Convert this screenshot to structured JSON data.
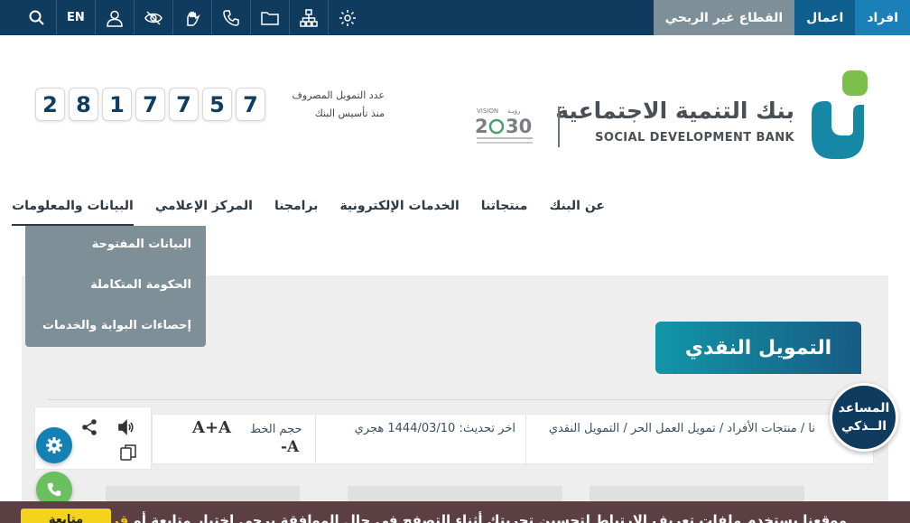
{
  "topbar": {
    "segments": [
      "افراد",
      "اعمال",
      "القطاع غير الربحي"
    ],
    "language": "EN",
    "tool_icons": [
      "search-icon",
      "language-toggle",
      "user-icon",
      "eye-slash-icon",
      "sign-language-icon",
      "phone-icon",
      "folder-icon",
      "sitemap-icon",
      "settings-icon"
    ]
  },
  "header": {
    "bank_name_ar": "بنك التنمية الاجتماعية",
    "bank_name_en": "SOCIAL DEVELOPMENT BANK",
    "vision_logo": "VISION 2030",
    "counter_label_1": "عدد التمويل المصروف",
    "counter_label_2": "منذ تأسيس البنك",
    "counter_digits": [
      "2",
      "8",
      "1",
      "7",
      "7",
      "5",
      "7"
    ]
  },
  "nav": {
    "items": [
      "عن البنك",
      "منتجاتنا",
      "الخدمات الإلكترونية",
      "برامجنا",
      "المركز الإعلامي",
      "البيانات والمعلومات"
    ],
    "active": "البيانات والمعلومات"
  },
  "dropdown": {
    "items": [
      "البيانات المفتوحة",
      "الحكومة المتكاملة",
      "إحصاءات البوابة والخدمات"
    ]
  },
  "page": {
    "title": "التمويل النقدي",
    "breadcrumb": "نا / منتجات الأفراد / تمويل العمل الحر / التمويل النقدي",
    "last_update": "اخر تحديث: 1444/03/10 هجري",
    "font_size_label": "حجم الخط",
    "font_increase": "A+A",
    "font_decrease": "-A"
  },
  "assistant": {
    "line1": "المساعد",
    "line2": "الــذكي"
  },
  "cookie": {
    "text": "موقعنا يستخدم ملفات تعريف الارتباط لتحسين تجربتك أثناء التصفح في حال الموافقة يرجى اختيار متابعة أو",
    "link": "قراءة المزيد",
    "button": "متابعة"
  },
  "colors": {
    "topbar": "#0f3b5f",
    "accent": "#1580b4",
    "teal": "#1296a6",
    "dropdown": "#7e8f98",
    "cookie_bar": "#5c3f42",
    "cookie_button": "#f5d31d"
  }
}
